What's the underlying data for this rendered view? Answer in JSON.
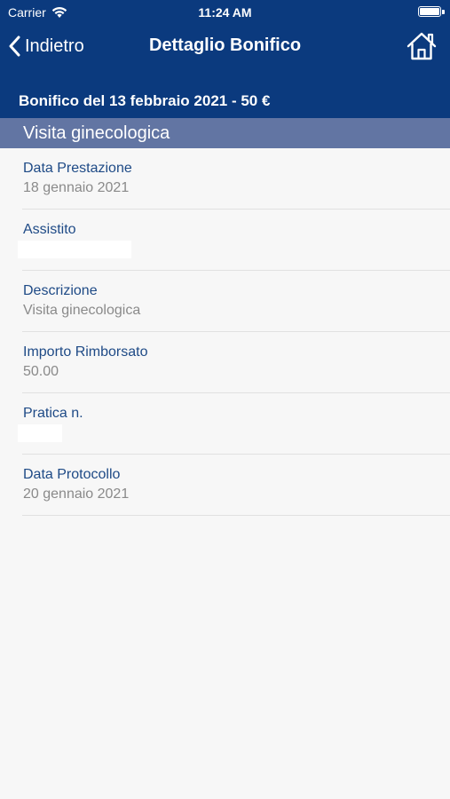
{
  "status_bar": {
    "carrier": "Carrier",
    "time": "11:24 AM"
  },
  "navbar": {
    "back_label": "Indietro",
    "title": "Dettaglio Bonifico",
    "home_icon": "home-icon"
  },
  "transfer": {
    "title": "Bonifico del 13 febbraio 2021 - 50 €"
  },
  "section": {
    "title": "Visita ginecologica"
  },
  "details": [
    {
      "label": "Data Prestazione",
      "value": "18 gennaio 2021"
    },
    {
      "label": "Assistito",
      "value": ""
    },
    {
      "label": "Descrizione",
      "value": "Visita ginecologica"
    },
    {
      "label": "Importo Rimborsato",
      "value": "50.00"
    },
    {
      "label": "Pratica n.",
      "value": ""
    },
    {
      "label": "Data Protocollo",
      "value": "20 gennaio 2021"
    }
  ],
  "colors": {
    "header": "#0b3a7e",
    "section": "#6275a3",
    "label": "#1e4a86",
    "value": "#8a8a8a",
    "background": "#f7f7f7"
  }
}
